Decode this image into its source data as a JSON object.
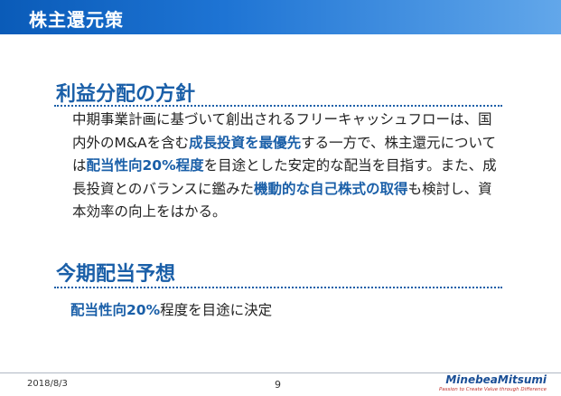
{
  "header": {
    "title": "株主還元策"
  },
  "policy": {
    "heading": "利益分配の方針",
    "parts": [
      "中期事業計画に基づいて創出されるフリーキャッシュフローは、国内外のM&Aを含む",
      "成長投資を最優先",
      "する一方で、株主還元については",
      "配当性向20%程度",
      "を目途とした安定的な配当を目指す。また、成長投資とのバランスに鑑みた",
      "機動的な自己株式の取得",
      "も検討し、資本効率の向上をはかる。"
    ]
  },
  "forecast": {
    "heading": "今期配当予想",
    "highlight": "配当性向20%",
    "rest": "程度を目途に決定"
  },
  "footer": {
    "date": "2018/8/3",
    "page": "9",
    "logo_name": "MinebeaMitsumi",
    "logo_tagline": "Passion to Create Value through Difference"
  },
  "colors": {
    "accent": "#1a5fa8",
    "header_start": "#0a5bb8",
    "header_end": "#62a7ea",
    "tagline": "#c0302a"
  }
}
